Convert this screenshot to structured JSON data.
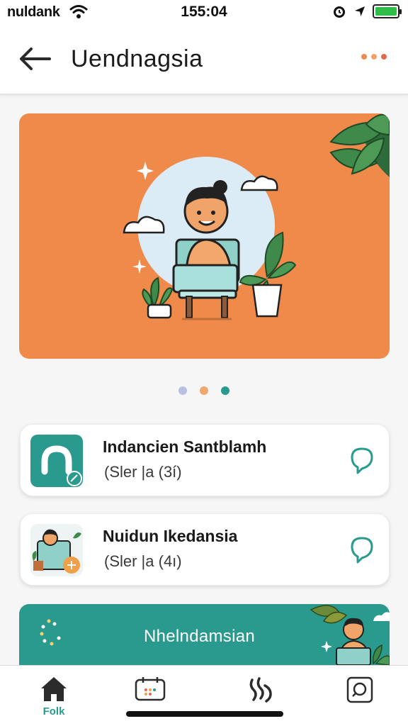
{
  "status_bar": {
    "carrier": "nuldank",
    "time": "155:04"
  },
  "header": {
    "title": "Uendnagsia"
  },
  "banner": {
    "illustration": "person-at-laptop-with-plants"
  },
  "carousel": {
    "page_count": 3,
    "active_index": 2,
    "colors": [
      "#b9bfe0",
      "#f0a86e",
      "#2a9a8e"
    ]
  },
  "list": [
    {
      "name": "Indancien Santblamh",
      "subtitle": "(Sler |a (3í)"
    },
    {
      "name": "Nuidun Ikedansia",
      "subtitle": "(Sler |a (4ı)"
    }
  ],
  "promo": {
    "title": "Nhelndamsian"
  },
  "tabs": [
    {
      "label": "Folk",
      "icon": "home-icon",
      "active": true
    },
    {
      "label": "",
      "icon": "calendar-icon",
      "active": false
    },
    {
      "label": "",
      "icon": "flame-icon",
      "active": false
    },
    {
      "label": "",
      "icon": "search-icon",
      "active": false
    }
  ],
  "colors": {
    "accent": "#2a9a8e",
    "banner": "#f08a4b",
    "background": "#f6f6f6"
  }
}
